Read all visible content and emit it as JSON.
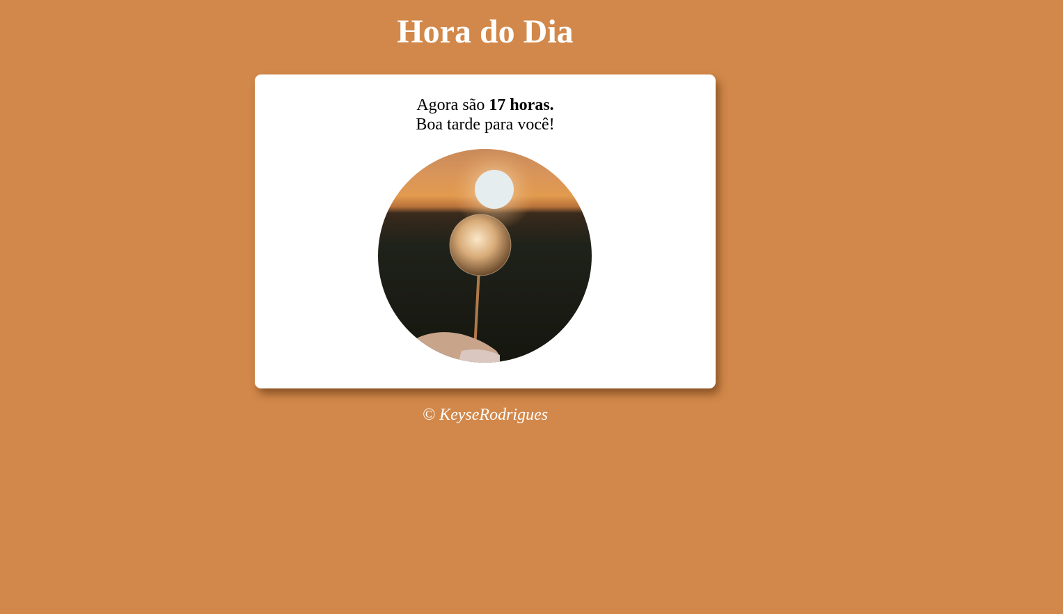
{
  "page": {
    "title": "Hora do Dia",
    "background_color": "#d2884a"
  },
  "card": {
    "prefix": "Agora são ",
    "hour_text": "17 horas.",
    "greeting": "Boa tarde para você!",
    "image_icon": "dandelion-sunset-photo"
  },
  "footer": {
    "copyright": "© KeyseRodrigues"
  }
}
